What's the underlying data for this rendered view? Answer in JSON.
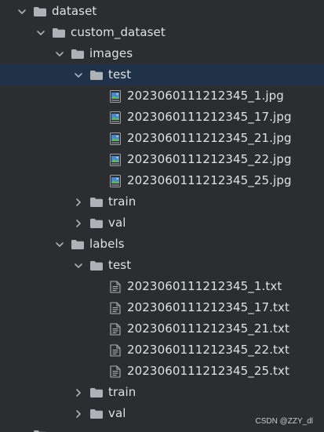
{
  "tree": [
    {
      "label": "dataset",
      "type": "folder",
      "depth": 0,
      "expanded": true,
      "selected": false,
      "icon": "folder-icon"
    },
    {
      "label": "custom_dataset",
      "type": "folder",
      "depth": 1,
      "expanded": true,
      "selected": false,
      "icon": "folder-icon"
    },
    {
      "label": "images",
      "type": "folder",
      "depth": 2,
      "expanded": true,
      "selected": false,
      "icon": "folder-icon"
    },
    {
      "label": "test",
      "type": "folder",
      "depth": 3,
      "expanded": true,
      "selected": true,
      "icon": "folder-icon"
    },
    {
      "label": "2023060111212345_1.jpg",
      "type": "image",
      "depth": 4,
      "selected": false,
      "icon": "image-file-icon"
    },
    {
      "label": "2023060111212345_17.jpg",
      "type": "image",
      "depth": 4,
      "selected": false,
      "icon": "image-file-icon"
    },
    {
      "label": "2023060111212345_21.jpg",
      "type": "image",
      "depth": 4,
      "selected": false,
      "icon": "image-file-icon"
    },
    {
      "label": "2023060111212345_22.jpg",
      "type": "image",
      "depth": 4,
      "selected": false,
      "icon": "image-file-icon"
    },
    {
      "label": "2023060111212345_25.jpg",
      "type": "image",
      "depth": 4,
      "selected": false,
      "icon": "image-file-icon"
    },
    {
      "label": "train",
      "type": "folder",
      "depth": 3,
      "expanded": false,
      "selected": false,
      "icon": "folder-icon"
    },
    {
      "label": "val",
      "type": "folder",
      "depth": 3,
      "expanded": false,
      "selected": false,
      "icon": "folder-icon"
    },
    {
      "label": "labels",
      "type": "folder",
      "depth": 2,
      "expanded": true,
      "selected": false,
      "icon": "folder-icon"
    },
    {
      "label": "test",
      "type": "folder",
      "depth": 3,
      "expanded": true,
      "selected": false,
      "icon": "folder-icon"
    },
    {
      "label": "2023060111212345_1.txt",
      "type": "text",
      "depth": 4,
      "selected": false,
      "icon": "text-file-icon"
    },
    {
      "label": "2023060111212345_17.txt",
      "type": "text",
      "depth": 4,
      "selected": false,
      "icon": "text-file-icon"
    },
    {
      "label": "2023060111212345_21.txt",
      "type": "text",
      "depth": 4,
      "selected": false,
      "icon": "text-file-icon"
    },
    {
      "label": "2023060111212345_22.txt",
      "type": "text",
      "depth": 4,
      "selected": false,
      "icon": "text-file-icon"
    },
    {
      "label": "2023060111212345_25.txt",
      "type": "text",
      "depth": 4,
      "selected": false,
      "icon": "text-file-icon"
    },
    {
      "label": "train",
      "type": "folder",
      "depth": 3,
      "expanded": false,
      "selected": false,
      "icon": "folder-icon"
    },
    {
      "label": "val",
      "type": "folder",
      "depth": 3,
      "expanded": false,
      "selected": false,
      "icon": "folder-icon"
    },
    {
      "label": "",
      "type": "folder",
      "depth": 0,
      "expanded": true,
      "selected": false,
      "icon": "folder-icon"
    }
  ],
  "watermark": "CSDN @ZZY_dl",
  "colors": {
    "background": "#2b2d30",
    "selected_row": "#1f3247",
    "text": "#dfe1e5",
    "folder": "#aeb1b7",
    "chevron": "#aeb1b7"
  }
}
